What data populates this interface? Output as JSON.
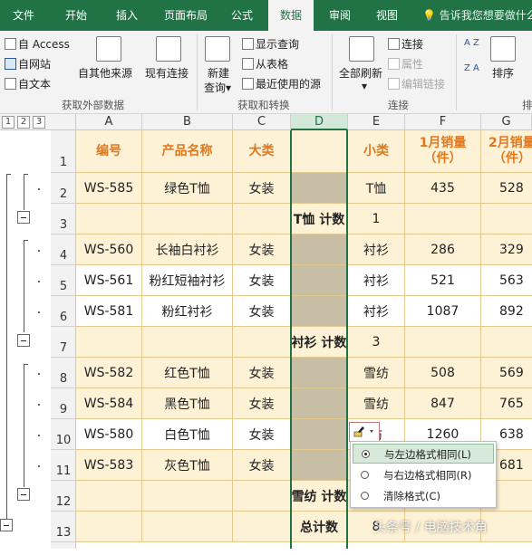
{
  "tabs": [
    "文件",
    "开始",
    "插入",
    "页面布局",
    "公式",
    "数据",
    "审阅",
    "视图"
  ],
  "active_tab": "数据",
  "tell_me": "告诉我您想要做什么",
  "ribbon": {
    "external": {
      "from_access": "自 Access",
      "from_web": "自网站",
      "from_text": "自文本",
      "from_other": "自其他来源",
      "existing": "现有连接",
      "label": "获取外部数据"
    },
    "transform": {
      "new_query_1": "新建",
      "new_query_2": "查询",
      "show_queries": "显示查询",
      "from_table": "从表格",
      "recent_sources": "最近使用的源",
      "label": "获取和转换"
    },
    "connections": {
      "refresh_all": "全部刷新",
      "connections": "连接",
      "properties": "属性",
      "edit_links": "编辑链接",
      "label": "连接"
    },
    "sort": {
      "sort": "排序",
      "sort_az_top": "A Z",
      "sort_za_top": "Z A",
      "label_partial": "排"
    }
  },
  "outline_levels": [
    "1",
    "2",
    "3"
  ],
  "columns": [
    "A",
    "B",
    "C",
    "D",
    "E",
    "F",
    "G"
  ],
  "header": {
    "a": "编号",
    "b": "产品名称",
    "c": "大类",
    "d": "",
    "e": "小类",
    "f": "1月销量\n（件）",
    "g": "2月销量\n（件）"
  },
  "rows": [
    {
      "n": "2",
      "a": "WS-585",
      "b": "绿色T恤",
      "c": "女装",
      "d": "",
      "e": "T恤",
      "f": "435",
      "g": "528"
    },
    {
      "n": "3",
      "a": "",
      "b": "",
      "c": "",
      "d": "T恤 计数",
      "e": "1",
      "f": "",
      "g": ""
    },
    {
      "n": "4",
      "a": "WS-560",
      "b": "长袖白衬衫",
      "c": "女装",
      "d": "",
      "e": "衬衫",
      "f": "286",
      "g": "329"
    },
    {
      "n": "5",
      "a": "WS-561",
      "b": "粉红短袖衬衫",
      "c": "女装",
      "d": "",
      "e": "衬衫",
      "f": "521",
      "g": "563"
    },
    {
      "n": "6",
      "a": "WS-581",
      "b": "粉红衬衫",
      "c": "女装",
      "d": "",
      "e": "衬衫",
      "f": "1087",
      "g": "892"
    },
    {
      "n": "7",
      "a": "",
      "b": "",
      "c": "",
      "d": "衬衫 计数",
      "e": "3",
      "f": "",
      "g": ""
    },
    {
      "n": "8",
      "a": "WS-582",
      "b": "红色T恤",
      "c": "女装",
      "d": "",
      "e": "雪纺",
      "f": "508",
      "g": "569"
    },
    {
      "n": "9",
      "a": "WS-584",
      "b": "黑色T恤",
      "c": "女装",
      "d": "",
      "e": "雪纺",
      "f": "847",
      "g": "765"
    },
    {
      "n": "10",
      "a": "WS-580",
      "b": "白色T恤",
      "c": "女装",
      "d": "",
      "e": "纺",
      "f": "1260",
      "g": "638"
    },
    {
      "n": "11",
      "a": "WS-583",
      "b": "灰色T恤",
      "c": "女装",
      "d": "",
      "e": "",
      "f": "",
      "g": "681"
    },
    {
      "n": "12",
      "a": "",
      "b": "",
      "c": "",
      "d": "雪纺 计数",
      "e": "",
      "f": "",
      "g": ""
    },
    {
      "n": "13",
      "a": "",
      "b": "",
      "c": "",
      "d": "总计数",
      "e": "8",
      "f": "",
      "g": ""
    }
  ],
  "row1_num": "1",
  "paste_menu": {
    "item1": "与左边格式相同(L)",
    "item2": "与右边格式相同(R)",
    "item3": "清除格式(C)"
  },
  "watermark": "头条号 / 电脑技术角",
  "colors": {
    "accent": "#217346",
    "header_text": "#e07820",
    "cream": "#fdf2d6",
    "subtotal_gray": "#c8bea6"
  }
}
